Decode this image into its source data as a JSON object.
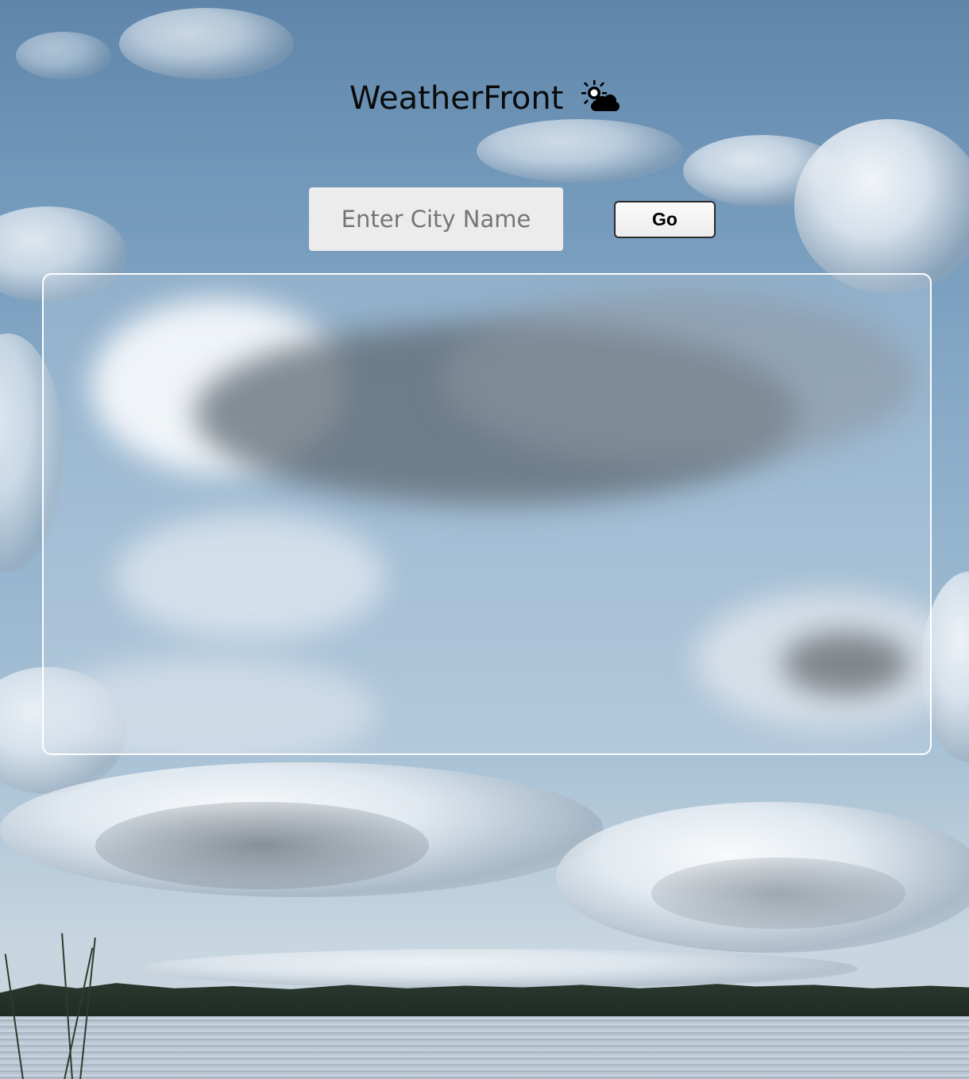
{
  "app": {
    "title": "WeatherFront",
    "title_icon": "sun-behind-cloud-icon"
  },
  "search": {
    "placeholder": "Enter City Name",
    "value": "",
    "go_label": "Go"
  },
  "result": {
    "empty": true
  },
  "colors": {
    "title_text": "#0b0b0b",
    "input_bg": "#ececec",
    "panel_border": "#ffffff",
    "button_border": "#2a2a2a"
  }
}
